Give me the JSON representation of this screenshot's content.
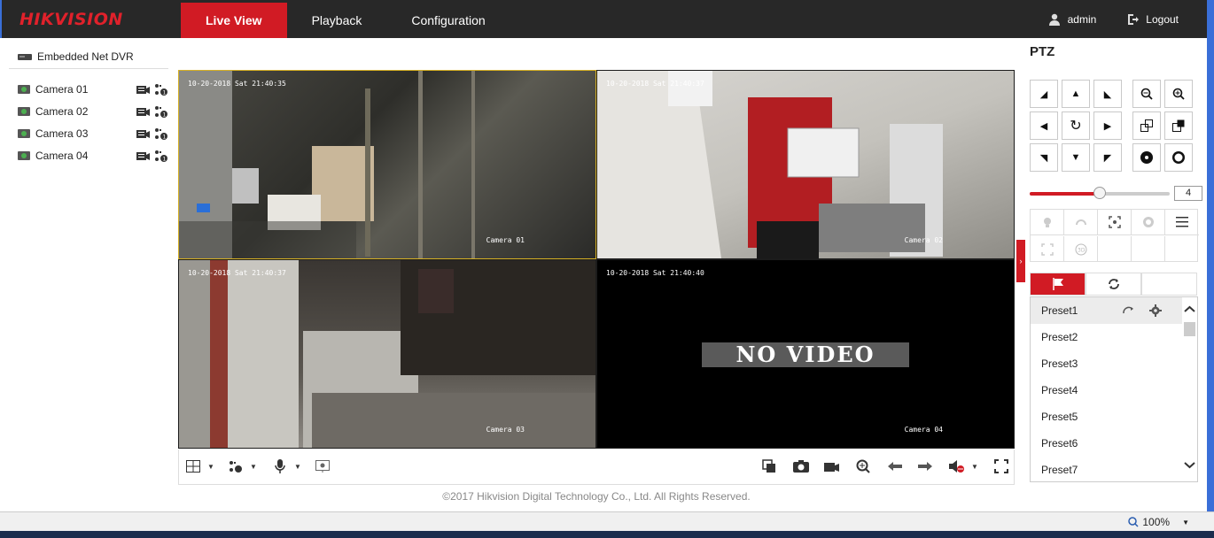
{
  "brand": {
    "logo_text": "HIKVISION",
    "accent_color": "#d11b24"
  },
  "nav": {
    "tabs": [
      {
        "label": "Live View",
        "active": true
      },
      {
        "label": "Playback",
        "active": false
      },
      {
        "label": "Configuration",
        "active": false
      }
    ]
  },
  "user": {
    "name": "admin",
    "logout_label": "Logout",
    "user_icon": "user-icon",
    "logout_icon": "logout-icon"
  },
  "sidebar": {
    "device_label": "Embedded Net DVR",
    "cameras": [
      {
        "label": "Camera 01"
      },
      {
        "label": "Camera 02"
      },
      {
        "label": "Camera 03"
      },
      {
        "label": "Camera 04"
      }
    ]
  },
  "video": {
    "tiles": [
      {
        "timestamp": "10-20-2018 Sat 21:40:35",
        "camera_name": "Camera 01",
        "selected": true
      },
      {
        "timestamp": "10-20-2018 Sat 21:40:37",
        "camera_name": "Camera 02",
        "selected": false
      },
      {
        "timestamp": "10-20-2018 Sat 21:40:37",
        "camera_name": "Camera 03",
        "selected": false
      },
      {
        "timestamp": "10-20-2018 Sat 21:40:40",
        "camera_name": "Camera 04",
        "selected": false,
        "no_video_text": "NO VIDEO"
      }
    ]
  },
  "footer": {
    "copyright": "©2017 Hikvision Digital Technology Co., Ltd. All Rights Reserved."
  },
  "ptz": {
    "title": "PTZ",
    "speed_value": "4",
    "speed_fraction": 0.5,
    "presets": [
      "Preset1",
      "Preset2",
      "Preset3",
      "Preset4",
      "Preset5",
      "Preset6",
      "Preset7"
    ],
    "selected_preset": "Preset1"
  },
  "statusbar": {
    "zoom": "100%"
  }
}
